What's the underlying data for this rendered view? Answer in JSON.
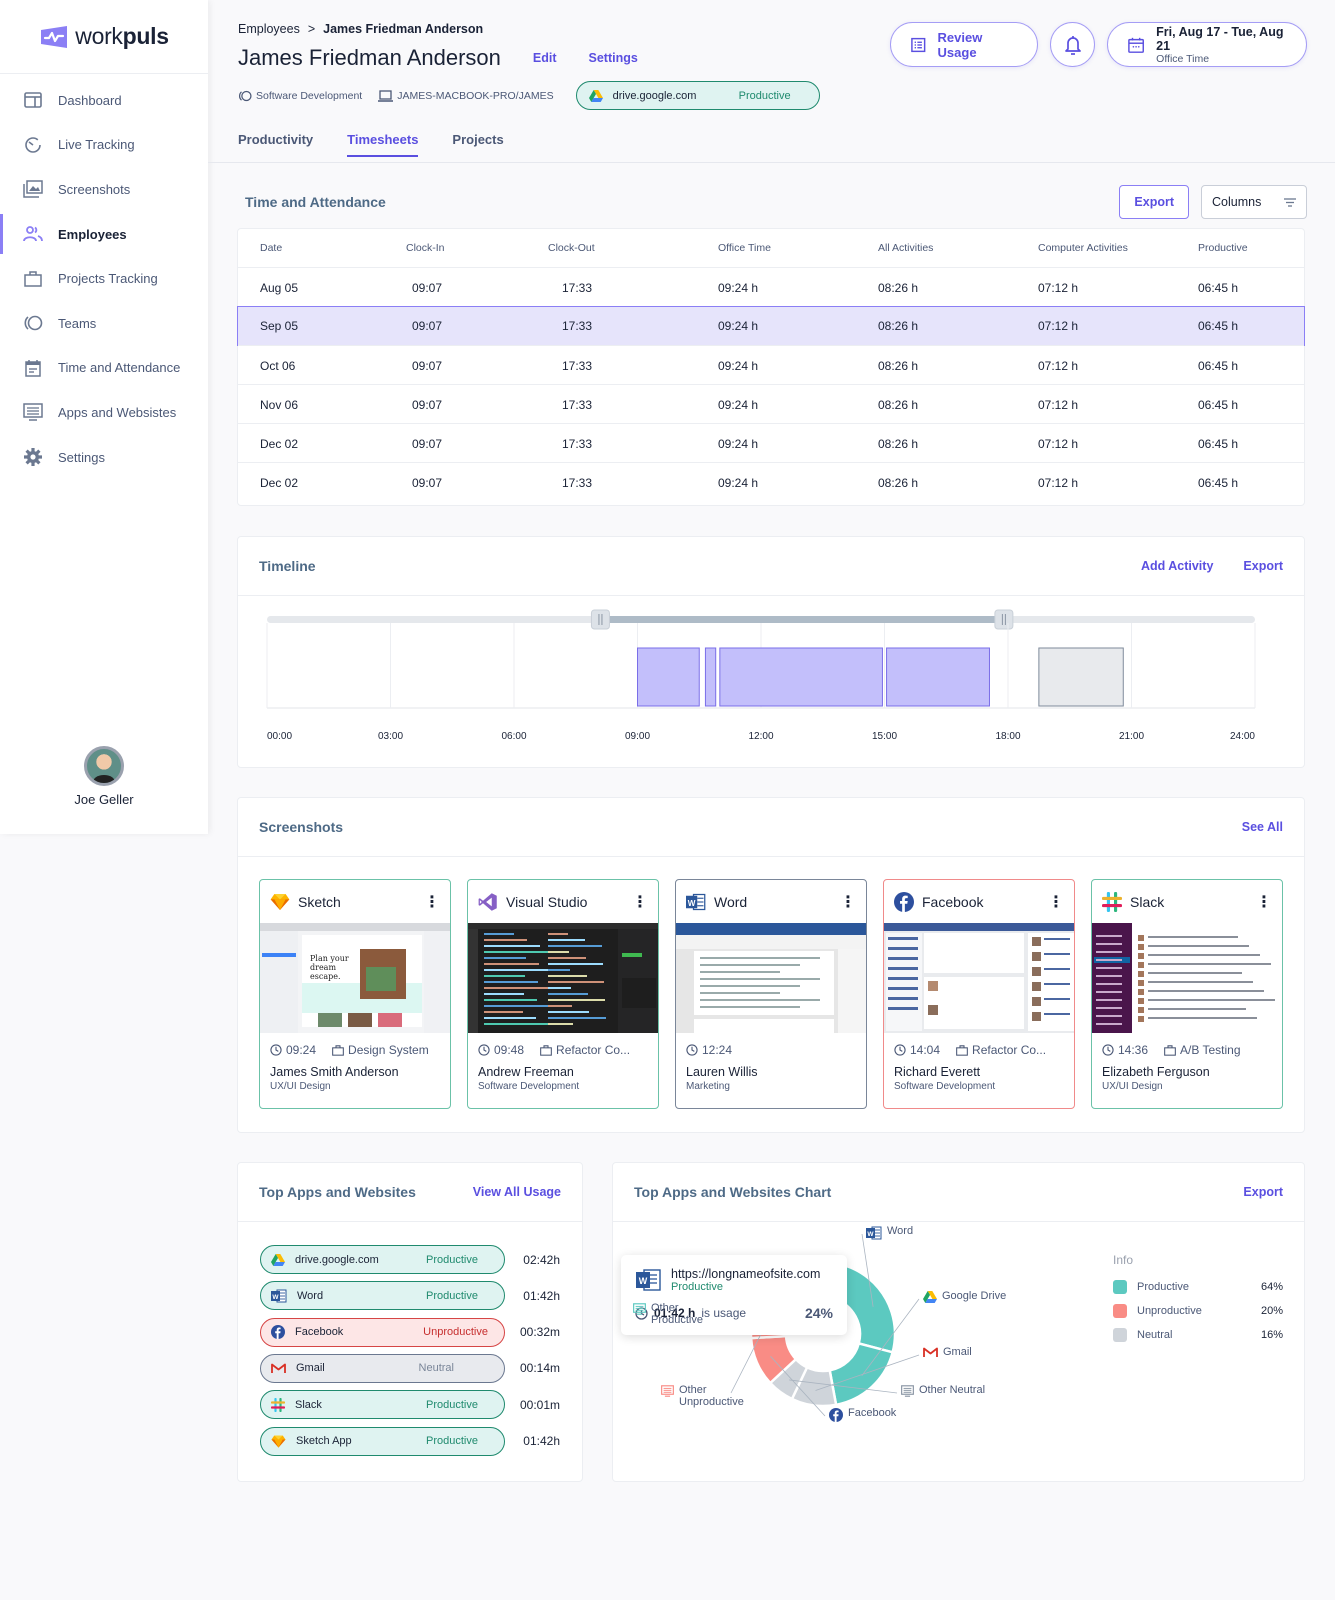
{
  "brand": {
    "name_light": "work",
    "name_bold": "puls",
    "accent": "#5a4fe0",
    "accent_light": "#8b7ff5"
  },
  "sidebar": {
    "items": [
      {
        "label": "Dashboard",
        "icon": "dashboard-icon",
        "active": false
      },
      {
        "label": "Live Tracking",
        "icon": "live-tracking-icon",
        "active": false
      },
      {
        "label": "Screenshots",
        "icon": "screenshots-icon",
        "active": false
      },
      {
        "label": "Employees",
        "icon": "employees-icon",
        "active": true
      },
      {
        "label": "Projects Tracking",
        "icon": "briefcase-icon",
        "active": false
      },
      {
        "label": "Teams",
        "icon": "teams-icon",
        "active": false
      },
      {
        "label": "Time and Attendance",
        "icon": "calendar-icon",
        "active": false
      },
      {
        "label": "Apps and Websistes",
        "icon": "monitor-list-icon",
        "active": false
      },
      {
        "label": "Settings",
        "icon": "gear-icon",
        "active": false
      }
    ],
    "user": {
      "name": "Joe Geller"
    }
  },
  "header": {
    "breadcrumb": {
      "parent": "Employees",
      "separator": ">",
      "current": "James Friedman Anderson"
    },
    "title": "James Friedman Anderson",
    "edit_label": "Edit",
    "settings_label": "Settings",
    "team": "Software Development",
    "device": "JAMES-MACBOOK-PRO/JAMES",
    "current_app": {
      "name": "drive.google.com",
      "status": "Productive"
    },
    "review_usage_label": "Review Usage",
    "date_range": "Fri, Aug 17 - Tue, Aug 21",
    "date_sub": "Office Time",
    "tabs": [
      {
        "label": "Productivity",
        "active": false
      },
      {
        "label": "Timesheets",
        "active": true
      },
      {
        "label": "Projects",
        "active": false
      }
    ]
  },
  "attendance": {
    "title": "Time and Attendance",
    "export_label": "Export",
    "columns_label": "Columns",
    "columns": [
      "Date",
      "Clock-In",
      "Clock-Out",
      "Office Time",
      "All Activities",
      "Computer Activities",
      "Productive"
    ],
    "rows": [
      {
        "date": "Aug 05",
        "clock_in": "09:07",
        "clock_out": "17:33",
        "office": "09:24 h",
        "all": "08:26 h",
        "computer": "07:12 h",
        "productive": "06:45 h",
        "selected": false
      },
      {
        "date": "Sep 05",
        "clock_in": "09:07",
        "clock_out": "17:33",
        "office": "09:24 h",
        "all": "08:26 h",
        "computer": "07:12 h",
        "productive": "06:45 h",
        "selected": true
      },
      {
        "date": "Oct 06",
        "clock_in": "09:07",
        "clock_out": "17:33",
        "office": "09:24 h",
        "all": "08:26 h",
        "computer": "07:12 h",
        "productive": "06:45 h",
        "selected": false
      },
      {
        "date": "Nov 06",
        "clock_in": "09:07",
        "clock_out": "17:33",
        "office": "09:24 h",
        "all": "08:26 h",
        "computer": "07:12 h",
        "productive": "06:45 h",
        "selected": false
      },
      {
        "date": "Dec 02",
        "clock_in": "09:07",
        "clock_out": "17:33",
        "office": "09:24 h",
        "all": "08:26 h",
        "computer": "07:12 h",
        "productive": "06:45 h",
        "selected": false
      },
      {
        "date": "Dec 02",
        "clock_in": "09:07",
        "clock_out": "17:33",
        "office": "09:24 h",
        "all": "08:26 h",
        "computer": "07:12 h",
        "productive": "06:45 h",
        "selected": false
      }
    ]
  },
  "timeline": {
    "title": "Timeline",
    "add_activity_label": "Add Activity",
    "export_label": "Export",
    "ticks": [
      "00:00",
      "03:00",
      "06:00",
      "09:00",
      "12:00",
      "15:00",
      "18:00",
      "21:00",
      "24:00"
    ],
    "range_hours": [
      8.1,
      17.9
    ],
    "activities": [
      {
        "start": 9.0,
        "end": 10.5,
        "type": "productive"
      },
      {
        "start": 10.65,
        "end": 10.9,
        "type": "productive"
      },
      {
        "start": 11.0,
        "end": 14.95,
        "type": "productive"
      },
      {
        "start": 15.05,
        "end": 17.55,
        "type": "productive"
      },
      {
        "start": 18.75,
        "end": 20.8,
        "type": "neutral"
      }
    ]
  },
  "screenshots": {
    "title": "Screenshots",
    "see_all_label": "See All",
    "items": [
      {
        "app": "Sketch",
        "icon": "sketch-icon",
        "time": "09:24",
        "project": "Design System",
        "name": "James Smith Anderson",
        "dept": "UX/UI Design",
        "status": "productive"
      },
      {
        "app": "Visual Studio",
        "icon": "visual-studio-icon",
        "time": "09:48",
        "project": "Refactor Co...",
        "name": "Andrew Freeman",
        "dept": "Software Development",
        "status": "productive"
      },
      {
        "app": "Word",
        "icon": "word-icon",
        "time": "12:24",
        "project": "",
        "name": "Lauren Willis",
        "dept": "Marketing",
        "status": "neutral"
      },
      {
        "app": "Facebook",
        "icon": "facebook-icon",
        "time": "14:04",
        "project": "Refactor Co...",
        "name": "Richard Everett",
        "dept": "Software Development",
        "status": "unproductive"
      },
      {
        "app": "Slack",
        "icon": "slack-icon",
        "time": "14:36",
        "project": "A/B Testing",
        "name": "Elizabeth Ferguson",
        "dept": "UX/UI Design",
        "status": "productive"
      }
    ]
  },
  "top_apps": {
    "title": "Top Apps and Websites",
    "view_all_label": "View All Usage",
    "items": [
      {
        "name": "drive.google.com",
        "icon": "google-drive-icon",
        "status": "Productive",
        "kind": "productive",
        "time": "02:42h"
      },
      {
        "name": "Word",
        "icon": "word-icon",
        "status": "Productive",
        "kind": "productive",
        "time": "01:42h"
      },
      {
        "name": "Facebook",
        "icon": "facebook-icon",
        "status": "Unproductive",
        "kind": "bad",
        "time": "00:32m"
      },
      {
        "name": "Gmail",
        "icon": "gmail-icon",
        "status": "Neutral",
        "kind": "neutral",
        "time": "00:14m"
      },
      {
        "name": "Slack",
        "icon": "slack-icon",
        "status": "Productive",
        "kind": "productive",
        "time": "00:01m"
      },
      {
        "name": "Sketch App",
        "icon": "sketch-icon",
        "status": "Productive",
        "kind": "productive",
        "time": "01:42h"
      }
    ]
  },
  "apps_chart": {
    "title": "Top Apps and  Websites Chart",
    "export_label": "Export",
    "tooltip": {
      "url": "https://longnameofsite.com",
      "status": "Productive",
      "time": "01:42 h",
      "time_suffix": "is usage",
      "percent": "24%"
    },
    "legend_title": "Info",
    "legend": [
      {
        "label": "Productive",
        "percent": "64%",
        "color": "#5cc9c0"
      },
      {
        "label": "Unproductive",
        "percent": "20%",
        "color": "#f98c85"
      },
      {
        "label": "Neutral",
        "percent": "16%",
        "color": "#cfd4da"
      }
    ]
  },
  "chart_data": {
    "type": "pie",
    "title": "Top Apps and  Websites Chart",
    "donut": true,
    "slices": [
      {
        "label": "Word",
        "value": 24,
        "category": "Productive",
        "color": "#5cc9c0"
      },
      {
        "label": "Google Drive",
        "value": 18,
        "category": "Productive",
        "color": "#5cc9c0"
      },
      {
        "label": "Gmail",
        "value": 10,
        "category": "Neutral",
        "color": "#cfd4da"
      },
      {
        "label": "Other Neutral",
        "value": 6,
        "category": "Neutral",
        "color": "#cfd4da"
      },
      {
        "label": "Facebook",
        "value": 11,
        "category": "Unproductive",
        "color": "#f98c85"
      },
      {
        "label": "Other Unproductive",
        "value": 9,
        "category": "Unproductive",
        "color": "#f98c85"
      },
      {
        "label": "Other Productive",
        "value": 22,
        "category": "Productive",
        "color": "#5cc9c0"
      }
    ],
    "legend": [
      {
        "label": "Productive",
        "value": 64
      },
      {
        "label": "Unproductive",
        "value": 20
      },
      {
        "label": "Neutral",
        "value": 16
      }
    ],
    "legend_position": "right"
  }
}
